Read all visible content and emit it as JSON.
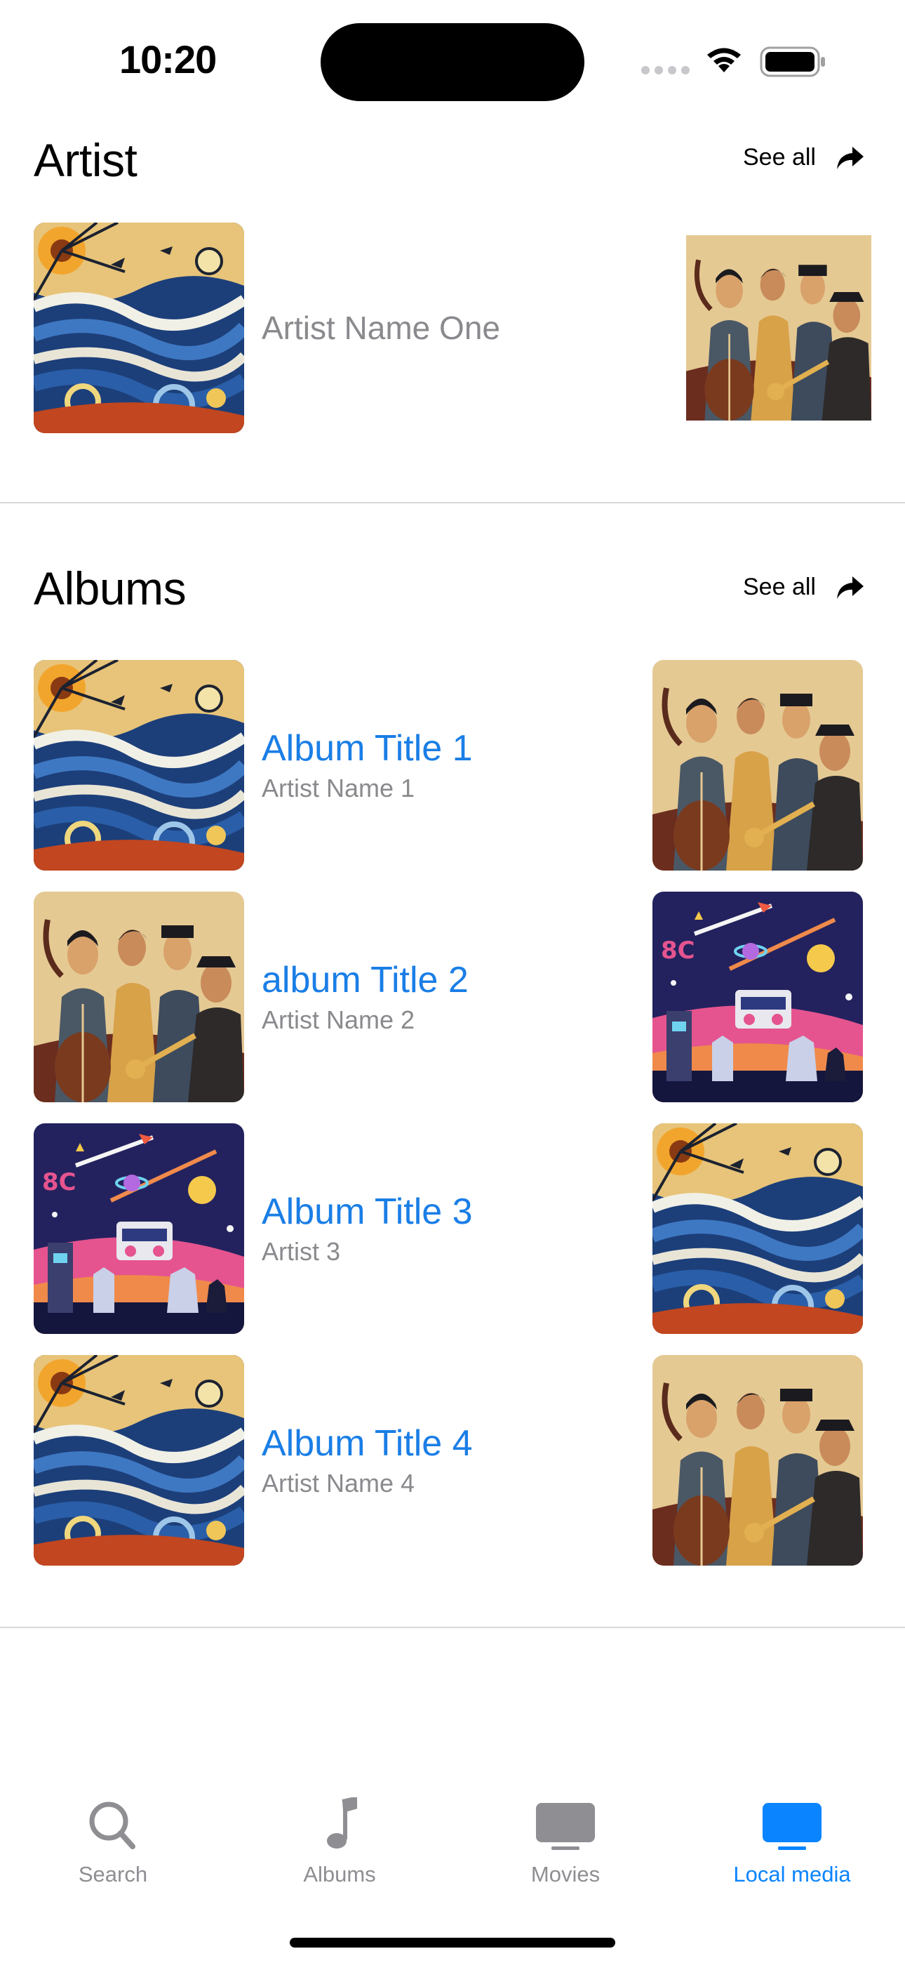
{
  "status": {
    "time": "10:20"
  },
  "artist_section": {
    "title": "Artist",
    "see_all": "See all",
    "items": [
      {
        "name": "Artist Name One",
        "art": "stained-glass-waves"
      },
      {
        "name": "",
        "art": "jazz-band"
      }
    ]
  },
  "albums_section": {
    "title": "Albums",
    "see_all": "See all",
    "items": [
      {
        "title": "Album Title 1",
        "artist": "Artist Name 1",
        "art": "stained-glass-waves",
        "side_art": "jazz-band"
      },
      {
        "title": "album Title 2",
        "artist": "Artist Name 2",
        "art": "jazz-band",
        "side_art": "retro-space-party"
      },
      {
        "title": "Album Title 3",
        "artist": "Artist 3",
        "art": "retro-space-party",
        "side_art": "stained-glass-waves"
      },
      {
        "title": "Album Title 4",
        "artist": "Artist Name 4",
        "art": "stained-glass-waves",
        "side_art": "jazz-band"
      }
    ]
  },
  "tabs": [
    {
      "label": "Search",
      "icon": "search-icon",
      "active": false
    },
    {
      "label": "Albums",
      "icon": "music-note-icon",
      "active": false
    },
    {
      "label": "Movies",
      "icon": "tv-icon",
      "active": false
    },
    {
      "label": "Local media",
      "icon": "tv-icon",
      "active": true
    }
  ],
  "colors": {
    "accent": "#0a84ff",
    "link": "#1a7ee6",
    "secondary_text": "#8a8a8e",
    "inactive_tab": "#8e8e93"
  }
}
